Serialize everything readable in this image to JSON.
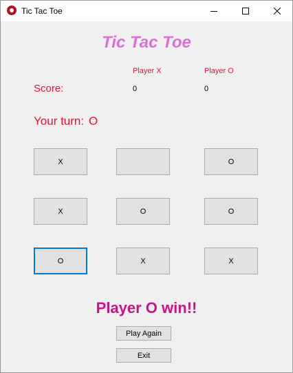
{
  "window": {
    "title": "Tic Tac Toe",
    "icon": "app-logo-icon",
    "controls": [
      "minimize-icon",
      "maximize-icon",
      "close-icon"
    ]
  },
  "game": {
    "title": "Tic Tac Toe",
    "score_label": "Score:",
    "player_x_label": "Player X",
    "player_o_label": "Player O",
    "score_x": "0",
    "score_o": "0",
    "turn_label": "Your turn:",
    "turn_value": "O",
    "board": [
      [
        "X",
        "",
        "O"
      ],
      [
        "X",
        "O",
        "O"
      ],
      [
        "O",
        "X",
        "X"
      ]
    ],
    "focused_cell": "row 3, column 1",
    "result": "Player O win!!",
    "play_again_label": "Play Again",
    "exit_label": "Exit"
  },
  "colors": {
    "title": "#da70d6",
    "labels": "#dc143c",
    "result": "#c71585",
    "focus_border": "#0078d7",
    "window_bg": "#f0f0f0"
  }
}
